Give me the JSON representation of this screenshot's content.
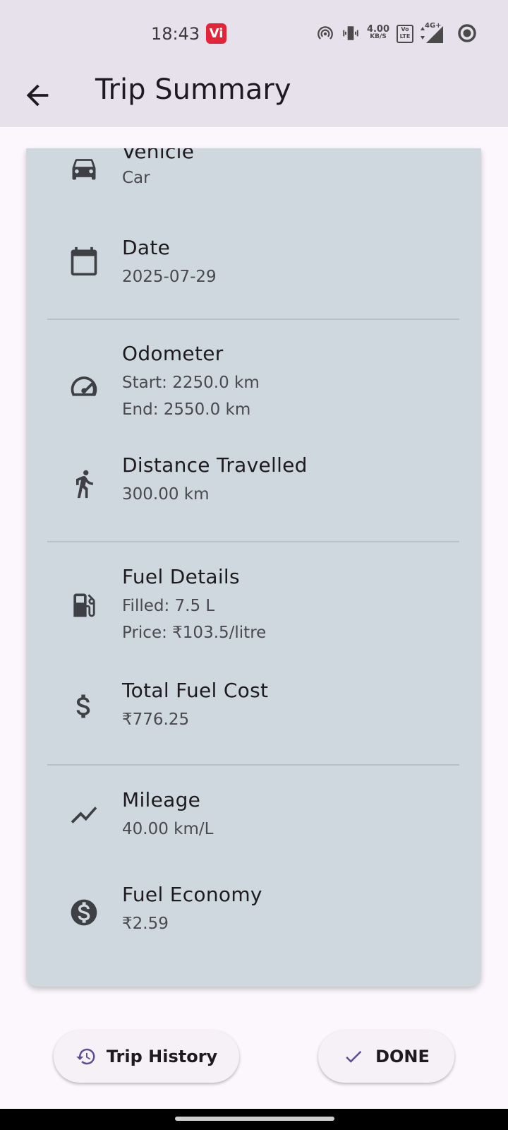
{
  "status_bar": {
    "time": "18:43",
    "carrier_badge": "Vi",
    "net_speed_value": "4.00",
    "net_speed_unit": "KB/S",
    "volte_label": "Vo LTE",
    "network_type": "4G+"
  },
  "app_bar": {
    "title": "Trip Summary"
  },
  "details": [
    {
      "icon": "car-icon",
      "title": "Vehicle",
      "lines": [
        "Car"
      ]
    },
    {
      "icon": "calendar-icon",
      "title": "Date",
      "lines": [
        "2025-07-29"
      ]
    },
    {
      "icon": "speedometer-icon",
      "title": "Odometer",
      "lines": [
        "Start: 2250.0 km",
        "End: 2550.0 km"
      ]
    },
    {
      "icon": "walking-person-icon",
      "title": "Distance Travelled",
      "lines": [
        "300.00 km"
      ]
    },
    {
      "icon": "fuel-pump-icon",
      "title": "Fuel Details",
      "lines": [
        "Filled: 7.5 L",
        "Price: ₹103.5/litre"
      ]
    },
    {
      "icon": "dollar-icon",
      "title": "Total Fuel Cost",
      "lines": [
        "₹776.25"
      ]
    },
    {
      "icon": "trend-line-icon",
      "title": "Mileage",
      "lines": [
        "40.00 km/L"
      ]
    },
    {
      "icon": "dollar-circle-icon",
      "title": "Fuel Economy",
      "lines": [
        "₹2.59"
      ]
    }
  ],
  "actions": {
    "history_label": "Trip History",
    "done_label": "DONE"
  },
  "colors": {
    "app_bar_bg": "#e7e1ec",
    "card_bg": "#cfd8de",
    "page_bg": "#fcf7fd",
    "accent": "#5b4f8f"
  }
}
